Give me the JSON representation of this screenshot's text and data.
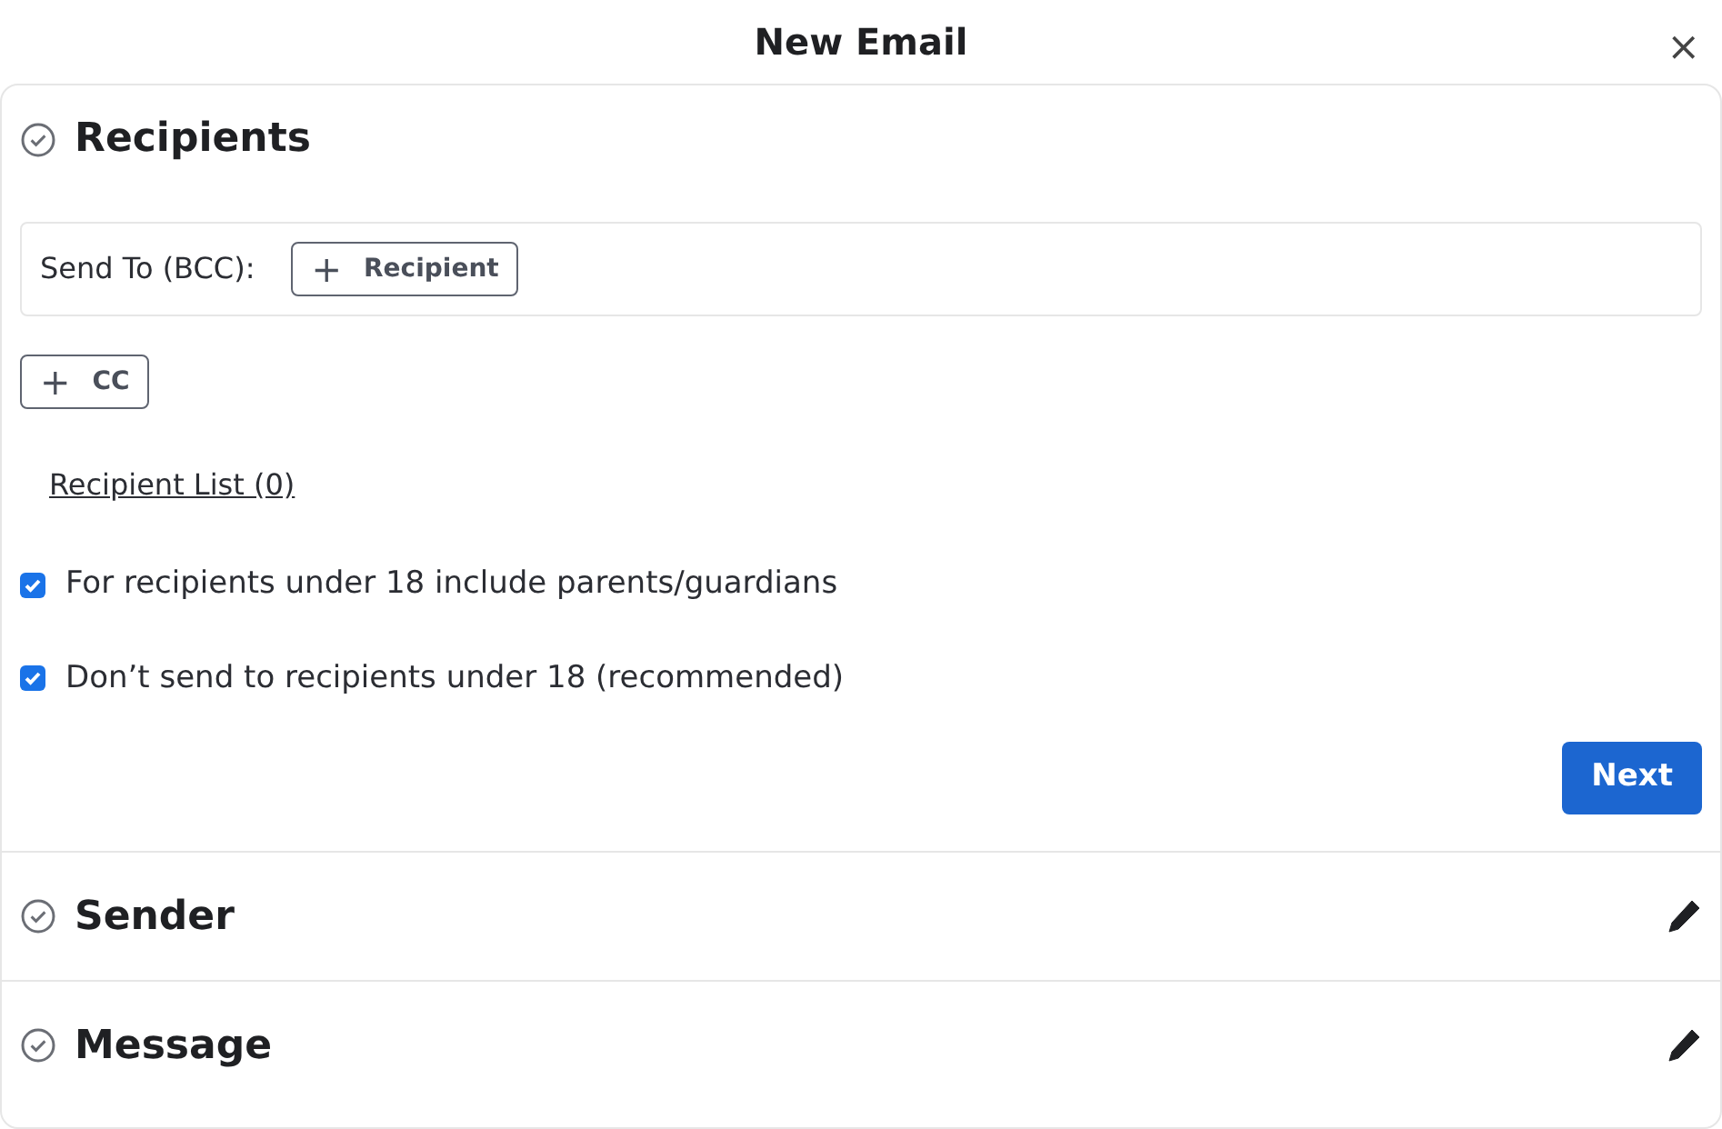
{
  "window": {
    "title": "New Email",
    "close": "×"
  },
  "recipients": {
    "title": "Recipients",
    "expanded": true,
    "send_to_label": "Send To (BCC):",
    "add_recipient": {
      "icon": "+",
      "label": "Recipient"
    },
    "add_cc": {
      "icon": "+",
      "label": "CC"
    },
    "recipient_list_link": "Recipient List (0)",
    "options": [
      {
        "label": "For recipients under 18 include parents/guardians",
        "checked": true
      },
      {
        "label": "Don’t send to recipients under 18 (recommended)",
        "checked": true
      }
    ],
    "next_button": "Next"
  },
  "sections": [
    {
      "title": "Sender",
      "expanded": false
    },
    {
      "title": "Message",
      "expanded": false
    }
  ]
}
